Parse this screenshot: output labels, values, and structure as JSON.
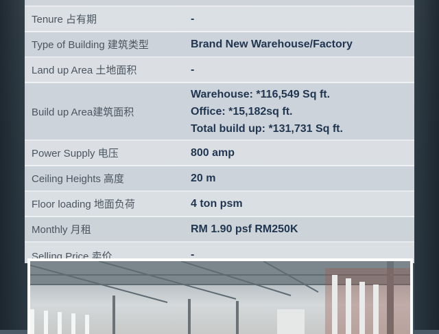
{
  "rows": [
    {
      "label": "Tenure 占有期",
      "value": [
        "-"
      ]
    },
    {
      "label": "Type of Building 建筑类型",
      "value": [
        "Brand New Warehouse/Factory"
      ]
    },
    {
      "label": "Land up Area 土地面积",
      "value": [
        "-"
      ]
    },
    {
      "label": "Build up Area建筑面积",
      "value": [
        "Warehouse: *116,549 Sq ft.",
        "Office: *15,182sq ft.",
        "Total build up: *131,731 Sq ft."
      ]
    },
    {
      "label": "Power Supply 电压",
      "value": [
        "800 amp"
      ]
    },
    {
      "label": "Ceiling Heights 高度",
      "value": [
        "20 m"
      ]
    },
    {
      "label": "Floor loading 地面负荷",
      "value": [
        "4 ton psm"
      ]
    },
    {
      "label": "Monthly 月租",
      "value": [
        "RM 1.90 psf RM250K"
      ]
    },
    {
      "label": "Selling Price 卖价",
      "value": [
        "-"
      ]
    }
  ]
}
